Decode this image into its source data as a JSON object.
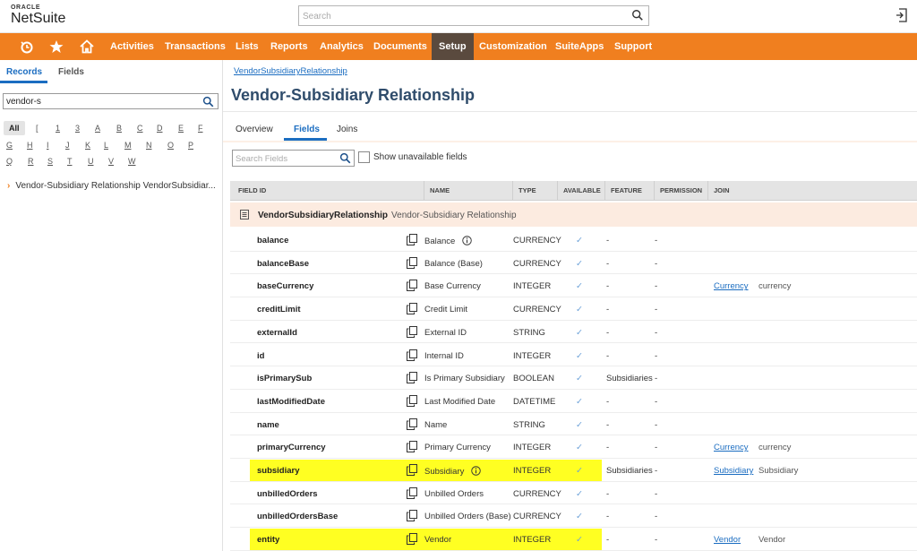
{
  "header": {
    "logo_top": "ORACLE",
    "logo_bottom": "NetSuite",
    "search_placeholder": "Search"
  },
  "nav": {
    "items": [
      "Activities",
      "Transactions",
      "Lists",
      "Reports",
      "Analytics",
      "Documents",
      "Setup",
      "Customization",
      "SuiteApps",
      "Support"
    ],
    "active": "Setup"
  },
  "left": {
    "tabs": [
      "Records",
      "Fields"
    ],
    "search_value": "vendor-s",
    "alpha_all": "All",
    "alpha_row1": [
      "[",
      "1",
      "3",
      "A",
      "B",
      "C",
      "D",
      "E",
      "F"
    ],
    "alpha_row2": [
      "G",
      "H",
      "I",
      "J",
      "K",
      "L",
      "M",
      "N",
      "O",
      "P"
    ],
    "alpha_row3": [
      "Q",
      "R",
      "S",
      "T",
      "U",
      "V",
      "W"
    ],
    "result": "Vendor-Subsidiary Relationship  VendorSubsidiar..."
  },
  "main": {
    "breadcrumb": "VendorSubsidiaryRelationship",
    "title": "Vendor-Subsidiary Relationship",
    "tabs": [
      "Overview",
      "Fields",
      "Joins"
    ],
    "fields_search_placeholder": "Search Fields",
    "show_unavailable": "Show unavailable fields",
    "columns": [
      "FIELD ID",
      "NAME",
      "TYPE",
      "AVAILABLE",
      "FEATURE",
      "PERMISSION",
      "JOIN"
    ],
    "group": {
      "id": "VendorSubsidiaryRelationship",
      "label": "Vendor-Subsidiary Relationship"
    },
    "rows": [
      {
        "id": "balance",
        "name": "Balance",
        "info": true,
        "type": "CURRENCY",
        "available": "✓",
        "feature": "-",
        "permission": "-",
        "join": "",
        "join_text": "",
        "highlight": false
      },
      {
        "id": "balanceBase",
        "name": "Balance (Base)",
        "info": false,
        "type": "CURRENCY",
        "available": "✓",
        "feature": "-",
        "permission": "-",
        "join": "",
        "join_text": "",
        "highlight": false
      },
      {
        "id": "baseCurrency",
        "name": "Base Currency",
        "info": false,
        "type": "INTEGER",
        "available": "✓",
        "feature": "-",
        "permission": "-",
        "join": "Currency",
        "join_text": "currency",
        "highlight": false
      },
      {
        "id": "creditLimit",
        "name": "Credit Limit",
        "info": false,
        "type": "CURRENCY",
        "available": "✓",
        "feature": "-",
        "permission": "-",
        "join": "",
        "join_text": "",
        "highlight": false
      },
      {
        "id": "externalId",
        "name": "External ID",
        "info": false,
        "type": "STRING",
        "available": "✓",
        "feature": "-",
        "permission": "-",
        "join": "",
        "join_text": "",
        "highlight": false
      },
      {
        "id": "id",
        "name": "Internal ID",
        "info": false,
        "type": "INTEGER",
        "available": "✓",
        "feature": "-",
        "permission": "-",
        "join": "",
        "join_text": "",
        "highlight": false
      },
      {
        "id": "isPrimarySub",
        "name": "Is Primary Subsidiary",
        "info": false,
        "type": "BOOLEAN",
        "available": "✓",
        "feature": "Subsidiaries",
        "permission": "-",
        "join": "",
        "join_text": "",
        "highlight": false
      },
      {
        "id": "lastModifiedDate",
        "name": "Last Modified Date",
        "info": false,
        "type": "DATETIME",
        "available": "✓",
        "feature": "-",
        "permission": "-",
        "join": "",
        "join_text": "",
        "highlight": false
      },
      {
        "id": "name",
        "name": "Name",
        "info": false,
        "type": "STRING",
        "available": "✓",
        "feature": "-",
        "permission": "-",
        "join": "",
        "join_text": "",
        "highlight": false
      },
      {
        "id": "primaryCurrency",
        "name": "Primary Currency",
        "info": false,
        "type": "INTEGER",
        "available": "✓",
        "feature": "-",
        "permission": "-",
        "join": "Currency",
        "join_text": "currency",
        "highlight": false
      },
      {
        "id": "subsidiary",
        "name": "Subsidiary",
        "info": true,
        "type": "INTEGER",
        "available": "✓",
        "feature": "Subsidiaries",
        "permission": "-",
        "join": "Subsidiary",
        "join_text": "Subsidiary",
        "highlight": true
      },
      {
        "id": "unbilledOrders",
        "name": "Unbilled Orders",
        "info": false,
        "type": "CURRENCY",
        "available": "✓",
        "feature": "-",
        "permission": "-",
        "join": "",
        "join_text": "",
        "highlight": false
      },
      {
        "id": "unbilledOrdersBase",
        "name": "Unbilled Orders (Base)",
        "info": false,
        "type": "CURRENCY",
        "available": "✓",
        "feature": "-",
        "permission": "-",
        "join": "",
        "join_text": "",
        "highlight": false
      },
      {
        "id": "entity",
        "name": "Vendor",
        "info": false,
        "type": "INTEGER",
        "available": "✓",
        "feature": "-",
        "permission": "-",
        "join": "Vendor",
        "join_text": "Vendor",
        "highlight": true
      }
    ]
  },
  "colors": {
    "nav": "#f07f1f",
    "active_nav": "#5a4a3e",
    "link": "#1b6dc1",
    "highlight": "#ffff22"
  }
}
